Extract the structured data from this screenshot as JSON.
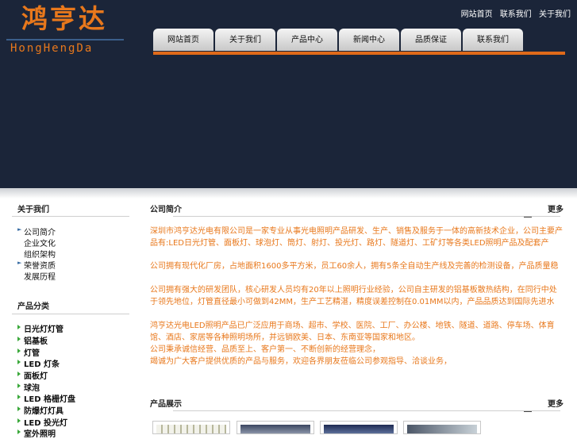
{
  "logo": {
    "cn": "鸿亨达",
    "en": "HongHengDa"
  },
  "top_links": [
    "网站首页",
    "联系我们",
    "关于我们"
  ],
  "nav": [
    "网站首页",
    "关于我们",
    "产品中心",
    "新闻中心",
    "品质保证",
    "联系我们"
  ],
  "colors": {
    "header_bg": "#1b2539",
    "accent": "#e06a1a",
    "text_orange": "#e8781c"
  },
  "left": {
    "about_title": "关于我们",
    "about_items": [
      "公司简介",
      "企业文化",
      "组织架构",
      "荣誉资质",
      "发展历程"
    ],
    "cat_title": "产品分类",
    "cat_items": [
      "日光灯灯管",
      "铝基板",
      "灯管",
      "LED 灯条",
      "面板灯",
      "球泡",
      "LED 格栅灯盘",
      "防爆灯灯具",
      "LED 投光灯",
      "室外照明"
    ]
  },
  "main": {
    "intro_title": "公司简介",
    "more": "更多",
    "paragraphs": [
      "深圳市鸿亨达光电有限公司是一家专业从事光电照明产品研发、生产、销售及服务于一体的高新技术企业，公司主要产品有:LED日光灯管、面板灯、球泡灯、筒灯、射灯、投光灯、路灯、隧道灯、工矿灯等各类LED照明产品及配套产品。",
      "公司拥有现代化厂房，占地面积1600多平方米，员工60余人，拥有5条全自动生产线及完善的检测设备，产品质量稳定可靠，深受广大客户好评。",
      "公司拥有强大的研发团队，核心研发人员均有20年以上照明行业经验，公司自主研发的铝基板散热结构，在同行中处于领先地位，灯管直径最小可做到42MM，生产工艺精湛，精度误差控制在0.01MM以内，产品品质达到国际先进水平。",
      "鸿亨达光电LED照明产品已广泛应用于商场、超市、学校、医院、工厂、办公楼、地铁、隧道、道路、停车场、体育馆、酒店、家居等各种照明场所，并远销欧美、日本、东南亚等国家和地区。\n 公司秉承诚信经营、品质至上、客户第一、不断创新的经营理念，\n 竭诚为广大客户提供优质的产品与服务，欢迎各界朋友莅临公司参观指导、洽谈业务，\n 共创美好的明天！"
    ],
    "products_title": "产品展示",
    "products_more": "更多"
  }
}
